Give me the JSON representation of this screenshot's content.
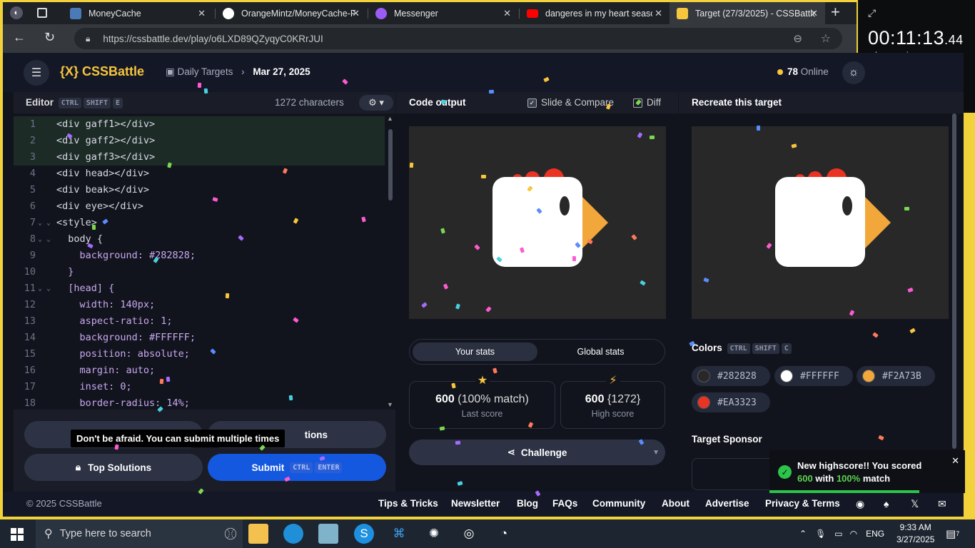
{
  "browser": {
    "tabs": [
      {
        "title": "MoneyCache",
        "icon_color": "#4a7ab8"
      },
      {
        "title": "OrangeMintz/MoneyCache-F",
        "icon_color": "#ffffff"
      },
      {
        "title": "Messenger",
        "icon_color": "#9b5cf6"
      },
      {
        "title": "dangeres in my heart season",
        "icon_color": "#ff0000"
      },
      {
        "title": "Target (27/3/2025) - CSSBattle",
        "icon_color": "#f7c63d"
      }
    ],
    "url": "https://cssbattle.dev/play/o6LXD89QZyqyC0KRrJUI"
  },
  "timer": {
    "time": "00:11:13",
    "fraction": ".44",
    "units": [
      "hr",
      "min",
      "sec"
    ]
  },
  "app": {
    "logo": "{X} CSSBattle",
    "breadcrumb": {
      "parent": "Daily Targets",
      "current": "Mar 27, 2025"
    },
    "online": {
      "count": "78",
      "label": "Online"
    }
  },
  "editor": {
    "title": "Editor",
    "shortcut": [
      "CTRL",
      "SHIFT",
      "E"
    ],
    "chars": "1272 characters",
    "lines": [
      {
        "n": "1",
        "t": "<div gaff1></div>"
      },
      {
        "n": "2",
        "t": "<div gaff2></div>"
      },
      {
        "n": "3",
        "t": "<div gaff3></div>"
      },
      {
        "n": "4",
        "t": "<div head></div>"
      },
      {
        "n": "5",
        "t": "<div beak></div>"
      },
      {
        "n": "6",
        "t": "<div eye></div>"
      },
      {
        "n": "7",
        "t": "<style>"
      },
      {
        "n": "8",
        "t": "  body {"
      },
      {
        "n": "9",
        "t": "    background: #282828;"
      },
      {
        "n": "10",
        "t": "  }"
      },
      {
        "n": "11",
        "t": "  [head] {"
      },
      {
        "n": "12",
        "t": "    width: 140px;"
      },
      {
        "n": "13",
        "t": "    aspect-ratio: 1;"
      },
      {
        "n": "14",
        "t": "    background: #FFFFFF;"
      },
      {
        "n": "15",
        "t": "    position: absolute;"
      },
      {
        "n": "16",
        "t": "    margin: auto;"
      },
      {
        "n": "17",
        "t": "    inset: 0;"
      },
      {
        "n": "18",
        "t": "    border-radius: 14%;"
      }
    ],
    "buttons": {
      "solutions_partial": "tions",
      "top_solutions": "Top Solutions",
      "submit": "Submit",
      "submit_keys": [
        "CTRL",
        "ENTER"
      ]
    },
    "tooltip": "Don't be afraid. You can submit multiple times"
  },
  "output": {
    "title": "Code output",
    "slide_compare": "Slide & Compare",
    "diff": "Diff",
    "stats_tabs": [
      "Your stats",
      "Global stats"
    ],
    "last_score": {
      "value": "600",
      "detail": "(100% match)",
      "label": "Last score"
    },
    "high_score": {
      "value": "600",
      "detail": "{1272}",
      "label": "High score"
    },
    "challenge": "Challenge"
  },
  "target": {
    "title": "Recreate this target",
    "colors_title": "Colors",
    "colors_keys": [
      "CTRL",
      "SHIFT",
      "C"
    ],
    "colors": [
      {
        "hex": "#282828"
      },
      {
        "hex": "#FFFFFF"
      },
      {
        "hex": "#F2A73B"
      },
      {
        "hex": "#EA3323"
      }
    ],
    "sponsor": "Target Sponsor"
  },
  "toast": {
    "line1": "New highscore!! You scored",
    "score": "600",
    "with": "with",
    "match": "100%",
    "tail": "match"
  },
  "footer": {
    "copyright": "© 2025 CSSBattle",
    "links": [
      "Tips & Tricks",
      "Newsletter",
      "Blog",
      "FAQs",
      "Community",
      "About",
      "Advertise",
      "Privacy & Terms"
    ]
  },
  "taskbar": {
    "search_placeholder": "Type here to search",
    "language": "ENG",
    "time": "9:33 AM",
    "date": "3/27/2025",
    "notifications": "7"
  }
}
